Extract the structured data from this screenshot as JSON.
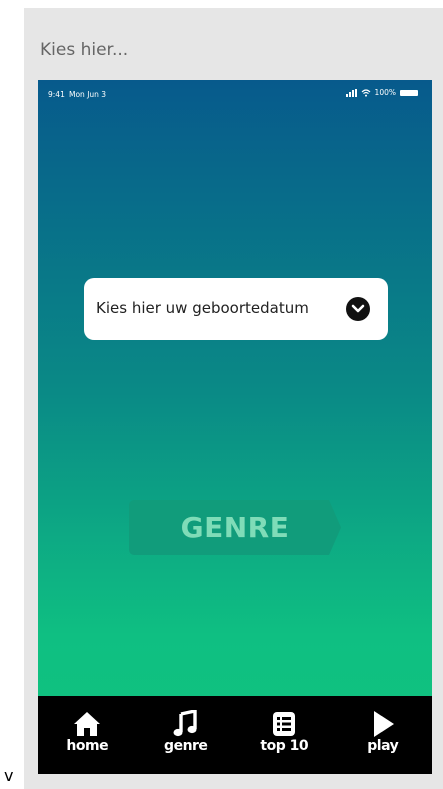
{
  "header": {
    "placeholder": "Kies hier..."
  },
  "edge_mark": "v",
  "status_bar": {
    "time": "9:41",
    "date": "Mon Jun 3",
    "battery": "100%"
  },
  "birthdate_select": {
    "label": "Kies hier uw geboortedatum"
  },
  "genre_button": {
    "label": "GENRE"
  },
  "tab_bar": {
    "items": [
      {
        "label": "home",
        "icon": "home-icon"
      },
      {
        "label": "genre",
        "icon": "music-note-icon"
      },
      {
        "label": "top 10",
        "icon": "list-icon"
      },
      {
        "label": "play",
        "icon": "play-icon"
      }
    ]
  },
  "colors": {
    "gradient_top": "#075a8c",
    "gradient_bottom": "#10c47d",
    "tab_bar": "#000000",
    "genre_text": "#7fdcb8"
  }
}
